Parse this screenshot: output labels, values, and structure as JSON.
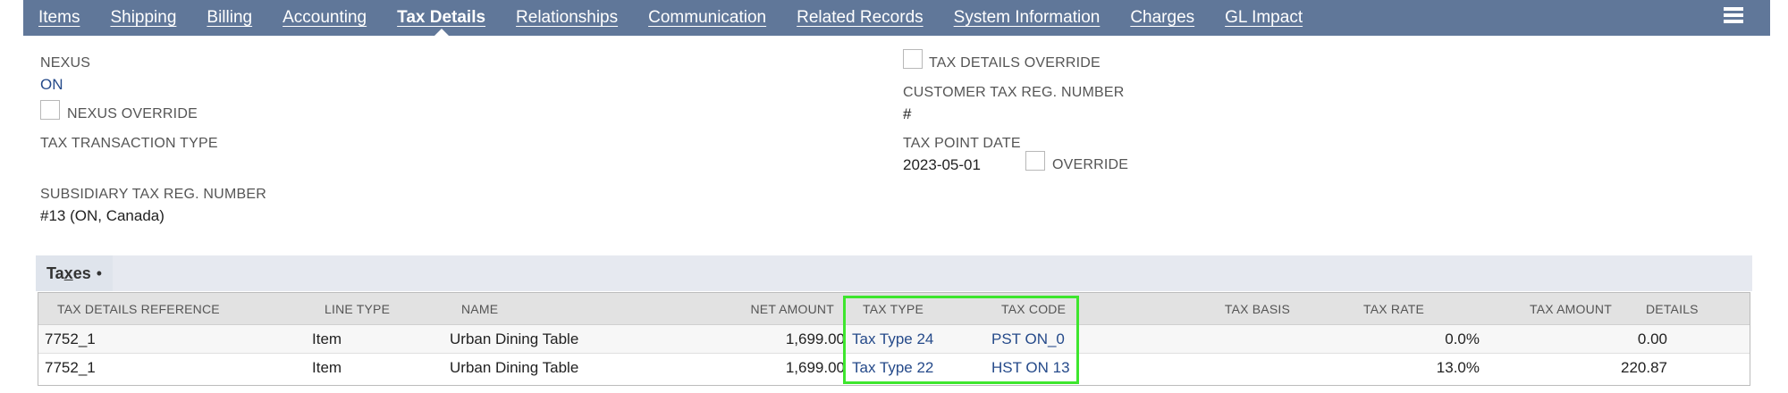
{
  "tabs": [
    {
      "label": "Items"
    },
    {
      "label": "Shipping"
    },
    {
      "label": "Billing"
    },
    {
      "label": "Accounting"
    },
    {
      "label": "Tax Details",
      "active": true
    },
    {
      "label": "Relationships"
    },
    {
      "label": "Communication"
    },
    {
      "label": "Related Records"
    },
    {
      "label": "System Information"
    },
    {
      "label": "Charges"
    },
    {
      "label": "GL Impact"
    }
  ],
  "left_fields": {
    "nexus_label": "NEXUS",
    "nexus_value": "ON",
    "nexus_override_label": "NEXUS OVERRIDE",
    "tax_transaction_type_label": "TAX TRANSACTION TYPE",
    "subsidiary_tax_reg_label": "SUBSIDIARY TAX REG. NUMBER",
    "subsidiary_tax_reg_value": "#13 (ON, Canada)"
  },
  "right_fields": {
    "tax_details_override_label": "TAX DETAILS OVERRIDE",
    "customer_tax_reg_label": "CUSTOMER TAX REG. NUMBER",
    "customer_tax_reg_value": "#",
    "tax_point_date_label": "TAX POINT DATE",
    "tax_point_date_value": "2023-05-01",
    "override_label": "OVERRIDE"
  },
  "taxes": {
    "subtab_label_pre": "Ta",
    "subtab_label_u": "x",
    "subtab_label_post": "es",
    "subtab_marker": "•",
    "columns": {
      "ref": "TAX DETAILS REFERENCE",
      "line_type": "LINE TYPE",
      "name": "NAME",
      "net_amount": "NET AMOUNT",
      "tax_type": "TAX TYPE",
      "tax_code": "TAX CODE",
      "tax_basis": "TAX BASIS",
      "tax_rate": "TAX RATE",
      "tax_amount": "TAX AMOUNT",
      "details": "DETAILS"
    },
    "rows": [
      {
        "ref": "7752_1",
        "line_type": "Item",
        "name": "Urban Dining Table",
        "net_amount": "1,699.00",
        "tax_type": "Tax Type 24",
        "tax_code": "PST ON_0",
        "tax_rate": "0.0%",
        "tax_amount": "0.00"
      },
      {
        "ref": "7752_1",
        "line_type": "Item",
        "name": "Urban Dining Table",
        "net_amount": "1,699.00",
        "tax_type": "Tax Type 22",
        "tax_code": "HST ON 13",
        "tax_rate": "13.0%",
        "tax_amount": "220.87"
      }
    ]
  },
  "colors": {
    "tabbar": "#607799",
    "link": "#254a8a",
    "highlight": "#3ee62e"
  }
}
